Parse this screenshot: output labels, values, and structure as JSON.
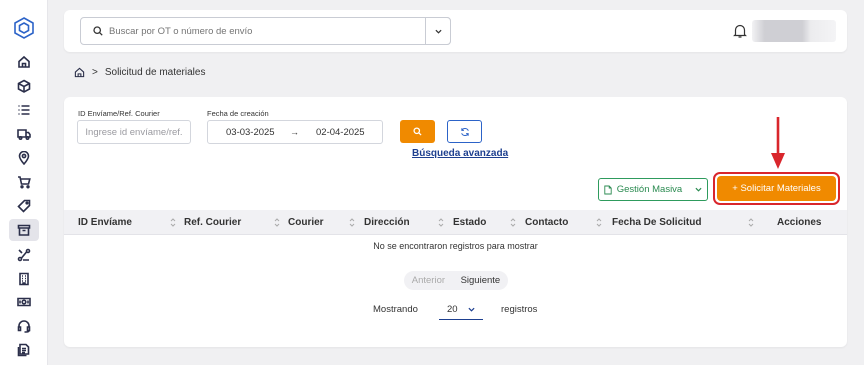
{
  "sidebar": {
    "logo_icon": "hexagon-logo-icon",
    "items": [
      {
        "icon": "home-icon",
        "active": false
      },
      {
        "icon": "box-icon",
        "active": false
      },
      {
        "icon": "list-icon",
        "active": false
      },
      {
        "icon": "truck-icon",
        "active": false
      },
      {
        "icon": "location-pin-icon",
        "active": false
      },
      {
        "icon": "cart-icon",
        "active": false
      },
      {
        "icon": "tag-icon",
        "active": false
      },
      {
        "icon": "archive-icon",
        "active": true
      },
      {
        "icon": "route-icon",
        "active": false
      },
      {
        "icon": "building-icon",
        "active": false
      },
      {
        "icon": "money-icon",
        "active": false
      },
      {
        "icon": "headset-icon",
        "active": false
      },
      {
        "icon": "document-stack-icon",
        "active": false
      }
    ]
  },
  "topbar": {
    "search_placeholder": "Buscar por OT o número de envío"
  },
  "breadcrumb": {
    "separator": ">",
    "current": "Solicitud de materiales"
  },
  "filters": {
    "id_label": "ID Envíame/Ref. Courier",
    "id_placeholder": "Ingrese id envíame/ref.",
    "date_label": "Fecha de creación",
    "date_from": "03-03-2025",
    "date_arrow": "→",
    "date_to": "02-04-2025",
    "advanced_link": "Búsqueda avanzada"
  },
  "actions": {
    "gestion_label": "Gestión Masiva",
    "solicitar_label": "+ Solicitar Materiales"
  },
  "table": {
    "columns": [
      "ID Envíame",
      "Ref. Courier",
      "Courier",
      "Dirección",
      "Estado",
      "Contacto",
      "Fecha De Solicitud",
      "Acciones"
    ],
    "empty_message": "No se encontraron registros para mostrar"
  },
  "pagination": {
    "prev_label": "Anterior",
    "next_label": "Siguiente",
    "showing_label": "Mostrando",
    "page_size": "20",
    "records_label": "registros"
  },
  "colors": {
    "primary_orange": "#f08a00",
    "link_blue": "#1d3f8f",
    "green": "#2e9b5d",
    "highlight_red": "#d9262c"
  }
}
